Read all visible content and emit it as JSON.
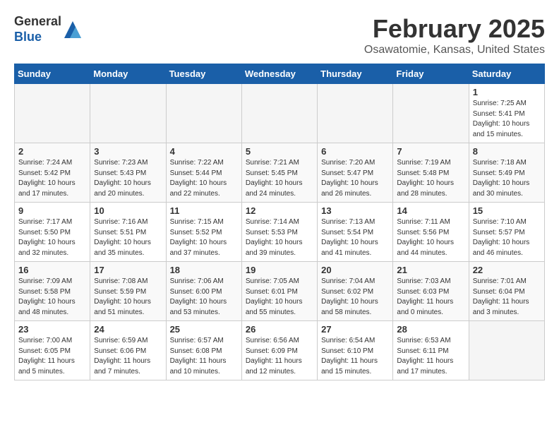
{
  "header": {
    "logo_general": "General",
    "logo_blue": "Blue",
    "title": "February 2025",
    "subtitle": "Osawatomie, Kansas, United States"
  },
  "days_of_week": [
    "Sunday",
    "Monday",
    "Tuesday",
    "Wednesday",
    "Thursday",
    "Friday",
    "Saturday"
  ],
  "weeks": [
    [
      {
        "num": "",
        "info": ""
      },
      {
        "num": "",
        "info": ""
      },
      {
        "num": "",
        "info": ""
      },
      {
        "num": "",
        "info": ""
      },
      {
        "num": "",
        "info": ""
      },
      {
        "num": "",
        "info": ""
      },
      {
        "num": "1",
        "info": "Sunrise: 7:25 AM\nSunset: 5:41 PM\nDaylight: 10 hours\nand 15 minutes."
      }
    ],
    [
      {
        "num": "2",
        "info": "Sunrise: 7:24 AM\nSunset: 5:42 PM\nDaylight: 10 hours\nand 17 minutes."
      },
      {
        "num": "3",
        "info": "Sunrise: 7:23 AM\nSunset: 5:43 PM\nDaylight: 10 hours\nand 20 minutes."
      },
      {
        "num": "4",
        "info": "Sunrise: 7:22 AM\nSunset: 5:44 PM\nDaylight: 10 hours\nand 22 minutes."
      },
      {
        "num": "5",
        "info": "Sunrise: 7:21 AM\nSunset: 5:45 PM\nDaylight: 10 hours\nand 24 minutes."
      },
      {
        "num": "6",
        "info": "Sunrise: 7:20 AM\nSunset: 5:47 PM\nDaylight: 10 hours\nand 26 minutes."
      },
      {
        "num": "7",
        "info": "Sunrise: 7:19 AM\nSunset: 5:48 PM\nDaylight: 10 hours\nand 28 minutes."
      },
      {
        "num": "8",
        "info": "Sunrise: 7:18 AM\nSunset: 5:49 PM\nDaylight: 10 hours\nand 30 minutes."
      }
    ],
    [
      {
        "num": "9",
        "info": "Sunrise: 7:17 AM\nSunset: 5:50 PM\nDaylight: 10 hours\nand 32 minutes."
      },
      {
        "num": "10",
        "info": "Sunrise: 7:16 AM\nSunset: 5:51 PM\nDaylight: 10 hours\nand 35 minutes."
      },
      {
        "num": "11",
        "info": "Sunrise: 7:15 AM\nSunset: 5:52 PM\nDaylight: 10 hours\nand 37 minutes."
      },
      {
        "num": "12",
        "info": "Sunrise: 7:14 AM\nSunset: 5:53 PM\nDaylight: 10 hours\nand 39 minutes."
      },
      {
        "num": "13",
        "info": "Sunrise: 7:13 AM\nSunset: 5:54 PM\nDaylight: 10 hours\nand 41 minutes."
      },
      {
        "num": "14",
        "info": "Sunrise: 7:11 AM\nSunset: 5:56 PM\nDaylight: 10 hours\nand 44 minutes."
      },
      {
        "num": "15",
        "info": "Sunrise: 7:10 AM\nSunset: 5:57 PM\nDaylight: 10 hours\nand 46 minutes."
      }
    ],
    [
      {
        "num": "16",
        "info": "Sunrise: 7:09 AM\nSunset: 5:58 PM\nDaylight: 10 hours\nand 48 minutes."
      },
      {
        "num": "17",
        "info": "Sunrise: 7:08 AM\nSunset: 5:59 PM\nDaylight: 10 hours\nand 51 minutes."
      },
      {
        "num": "18",
        "info": "Sunrise: 7:06 AM\nSunset: 6:00 PM\nDaylight: 10 hours\nand 53 minutes."
      },
      {
        "num": "19",
        "info": "Sunrise: 7:05 AM\nSunset: 6:01 PM\nDaylight: 10 hours\nand 55 minutes."
      },
      {
        "num": "20",
        "info": "Sunrise: 7:04 AM\nSunset: 6:02 PM\nDaylight: 10 hours\nand 58 minutes."
      },
      {
        "num": "21",
        "info": "Sunrise: 7:03 AM\nSunset: 6:03 PM\nDaylight: 11 hours\nand 0 minutes."
      },
      {
        "num": "22",
        "info": "Sunrise: 7:01 AM\nSunset: 6:04 PM\nDaylight: 11 hours\nand 3 minutes."
      }
    ],
    [
      {
        "num": "23",
        "info": "Sunrise: 7:00 AM\nSunset: 6:05 PM\nDaylight: 11 hours\nand 5 minutes."
      },
      {
        "num": "24",
        "info": "Sunrise: 6:59 AM\nSunset: 6:06 PM\nDaylight: 11 hours\nand 7 minutes."
      },
      {
        "num": "25",
        "info": "Sunrise: 6:57 AM\nSunset: 6:08 PM\nDaylight: 11 hours\nand 10 minutes."
      },
      {
        "num": "26",
        "info": "Sunrise: 6:56 AM\nSunset: 6:09 PM\nDaylight: 11 hours\nand 12 minutes."
      },
      {
        "num": "27",
        "info": "Sunrise: 6:54 AM\nSunset: 6:10 PM\nDaylight: 11 hours\nand 15 minutes."
      },
      {
        "num": "28",
        "info": "Sunrise: 6:53 AM\nSunset: 6:11 PM\nDaylight: 11 hours\nand 17 minutes."
      },
      {
        "num": "",
        "info": ""
      }
    ]
  ]
}
